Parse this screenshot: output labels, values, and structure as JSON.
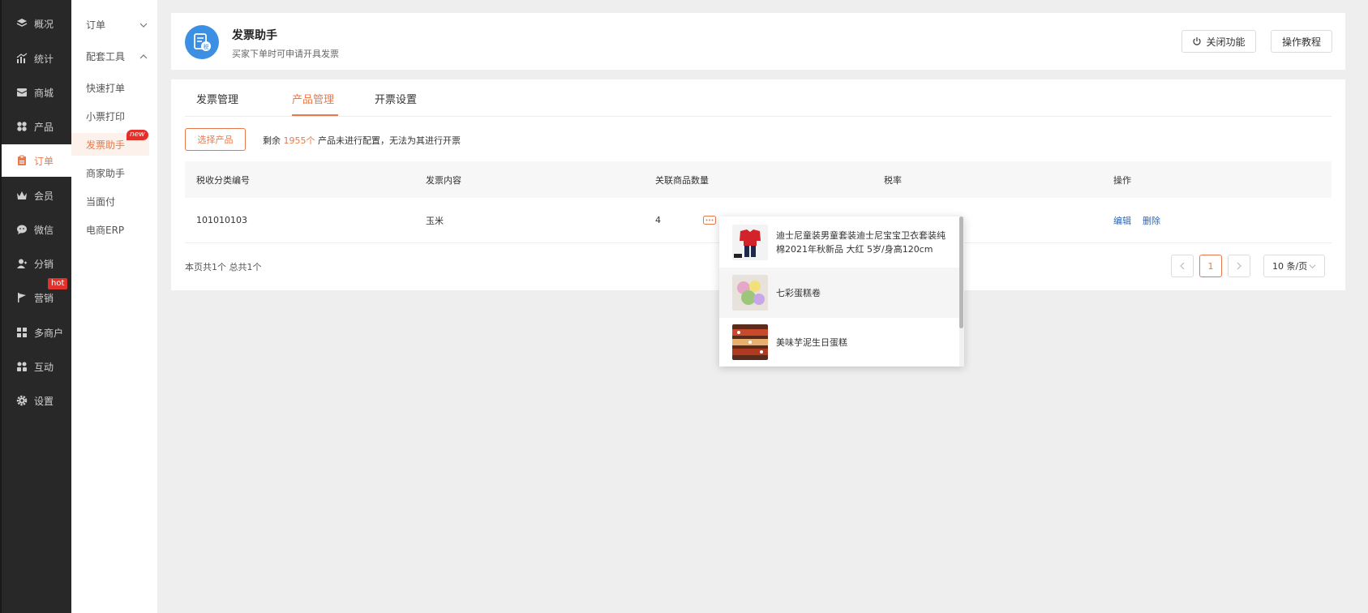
{
  "nav": {
    "items": [
      {
        "label": "概况",
        "icon": "layers-icon"
      },
      {
        "label": "统计",
        "icon": "chart-icon"
      },
      {
        "label": "商城",
        "icon": "mail-icon"
      },
      {
        "label": "产品",
        "icon": "grid-icon"
      },
      {
        "label": "订单",
        "icon": "clipboard-icon"
      },
      {
        "label": "会员",
        "icon": "crown-icon"
      },
      {
        "label": "微信",
        "icon": "wechat-icon"
      },
      {
        "label": "分销",
        "icon": "user-icon"
      },
      {
        "label": "营销",
        "icon": "flag-icon"
      },
      {
        "label": "多商户",
        "icon": "store-icon"
      },
      {
        "label": "互动",
        "icon": "interact-icon"
      },
      {
        "label": "设置",
        "icon": "gear-icon"
      }
    ],
    "active": "订单",
    "hot_badge": "hot",
    "accent": "#e9794a"
  },
  "subnav": {
    "group_order": "订单",
    "group_tools": "配套工具",
    "items": [
      {
        "label": "快速打单"
      },
      {
        "label": "小票打印"
      },
      {
        "label": "发票助手"
      },
      {
        "label": "商家助手"
      },
      {
        "label": "当面付"
      },
      {
        "label": "电商ERP"
      }
    ],
    "new_badge": "new"
  },
  "header": {
    "title": "发票助手",
    "desc": "买家下单时可申请开具发票",
    "close_btn": "关闭功能",
    "guide_btn": "操作教程"
  },
  "tabs": [
    {
      "label": "发票管理"
    },
    {
      "label": "产品管理"
    },
    {
      "label": "开票设置"
    }
  ],
  "toolbar": {
    "select_btn": "选择产品",
    "remain_prefix": "剩余",
    "remain_count": "1955个",
    "remain_suffix": "产品未进行配置，无法为其进行开票"
  },
  "table": {
    "headers": [
      "税收分类编号",
      "发票内容",
      "关联商品数量",
      "税率",
      "操作"
    ],
    "rows": [
      {
        "code": "101010103",
        "content": "玉米",
        "count": "4",
        "rate": "",
        "edit": "编辑",
        "delete": "删除"
      }
    ]
  },
  "footer": {
    "summary": "本页共1个 总共1个",
    "current_page": "1",
    "page_size": "10 条/页"
  },
  "popover": {
    "items": [
      {
        "name": "迪士尼童装男童套装迪士尼宝宝卫衣套装纯棉2021年秋新品 大红 5岁/身高120cm"
      },
      {
        "name": "七彩蛋糕卷"
      },
      {
        "name": "美味芋泥生日蛋糕"
      }
    ]
  }
}
